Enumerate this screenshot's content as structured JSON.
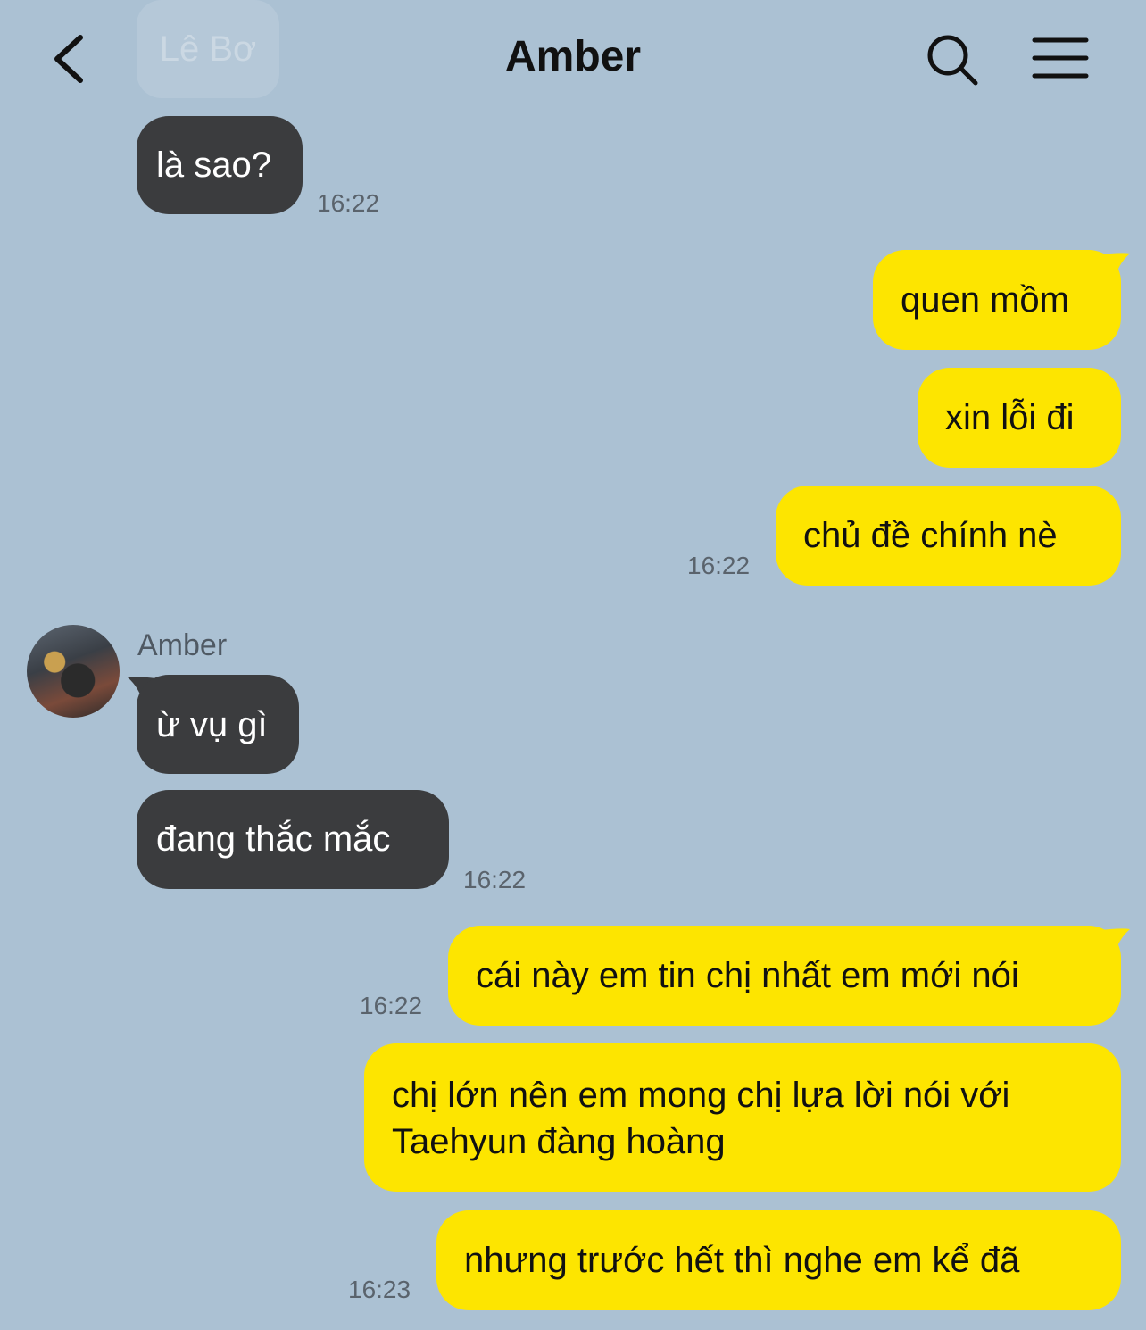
{
  "header": {
    "back_icon": "chevron-left-icon",
    "title": "Amber",
    "search_icon": "search-icon",
    "menu_icon": "hamburger-menu-icon",
    "pinned_tag": "Lê Bơ"
  },
  "colors": {
    "background": "#abc1d3",
    "incoming_bubble": "#3b3c3e",
    "outgoing_bubble": "#fde500"
  },
  "messages": [
    {
      "id": "m1",
      "dir": "in",
      "text": "là sao?",
      "time": "16:22"
    },
    {
      "id": "m2",
      "dir": "out",
      "text": "quen mồm"
    },
    {
      "id": "m3",
      "dir": "out",
      "text": "xin lỗi đi"
    },
    {
      "id": "m4",
      "dir": "out",
      "text": "chủ đề chính nè",
      "time": "16:22"
    },
    {
      "id": "m5",
      "dir": "in",
      "sender": "Amber",
      "text": "ừ vụ gì"
    },
    {
      "id": "m6",
      "dir": "in",
      "text": "đang thắc mắc",
      "time": "16:22"
    },
    {
      "id": "m7",
      "dir": "out",
      "text": "cái này em tin chị nhất em mới nói",
      "time": "16:22"
    },
    {
      "id": "m8",
      "dir": "out",
      "text_line1": "chị lớn nên em mong chị lựa lời nói với",
      "text_line2": "Taehyun đàng hoàng"
    },
    {
      "id": "m9",
      "dir": "out",
      "text": "nhưng trước hết thì nghe em kể đã",
      "time": "16:23"
    }
  ]
}
